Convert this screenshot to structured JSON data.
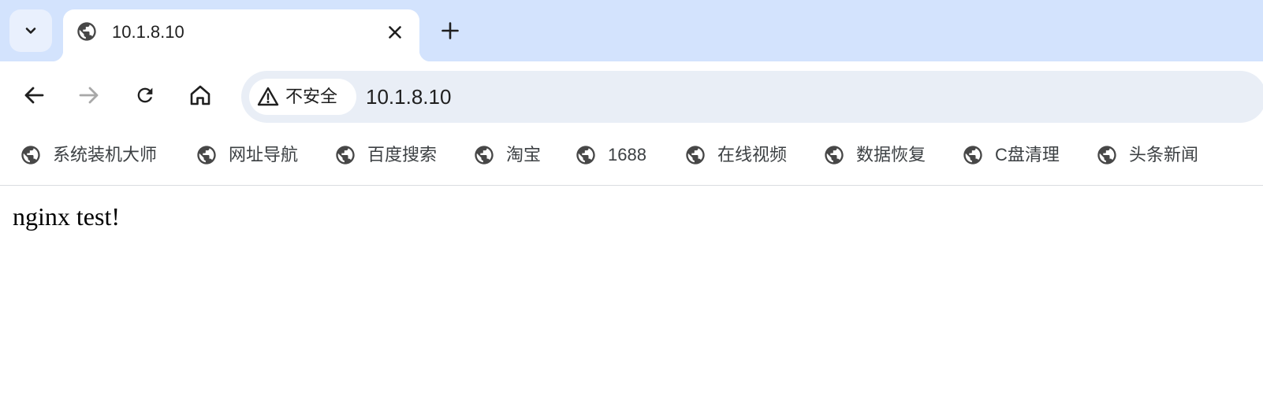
{
  "colors": {
    "tabstrip_bg": "#d3e3fd",
    "omnibox_bg": "#e9eef6",
    "icon": "#474747",
    "icon_disabled": "#a8a8a8"
  },
  "tabs": [
    {
      "title": "10.1.8.10",
      "icon": "globe-icon",
      "active": true
    }
  ],
  "toolbar": {
    "security_label": "不安全",
    "url": "10.1.8.10"
  },
  "bookmarks": [
    {
      "label": "系统装机大师",
      "icon": "globe-icon"
    },
    {
      "label": "网址导航",
      "icon": "globe-icon"
    },
    {
      "label": "百度搜索",
      "icon": "globe-icon"
    },
    {
      "label": "淘宝",
      "icon": "globe-icon"
    },
    {
      "label": "1688",
      "icon": "globe-icon"
    },
    {
      "label": "在线视频",
      "icon": "globe-icon"
    },
    {
      "label": "数据恢复",
      "icon": "globe-icon"
    },
    {
      "label": "C盘清理",
      "icon": "globe-icon"
    },
    {
      "label": "头条新闻",
      "icon": "globe-icon"
    }
  ],
  "page": {
    "body_text": "nginx test!"
  }
}
